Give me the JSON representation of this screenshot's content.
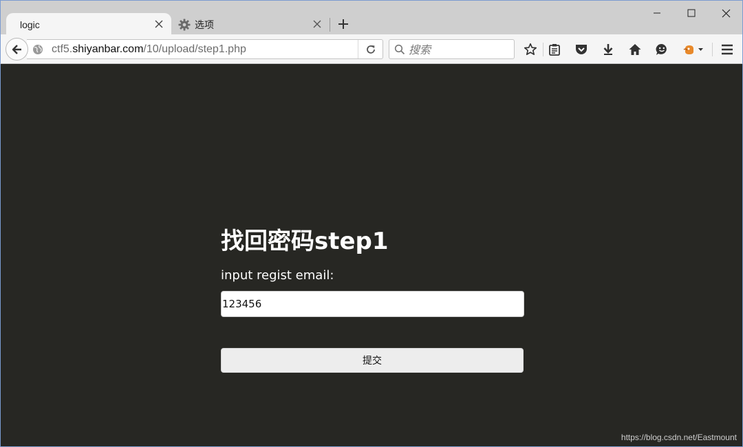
{
  "browser": {
    "tabs": [
      {
        "label": "logic",
        "active": true
      },
      {
        "label": "选项",
        "active": false
      }
    ],
    "url": {
      "prefix": "ctf5.",
      "host": "shiyanbar.com",
      "path": "/10/upload/step1.php"
    },
    "search_placeholder": "搜索"
  },
  "page": {
    "title": "找回密码step1",
    "field_label": "input regist email:",
    "email_value": "123456",
    "submit_label": "提交",
    "background_color": "#272723"
  },
  "watermark": "https://blog.csdn.net/Eastmount"
}
